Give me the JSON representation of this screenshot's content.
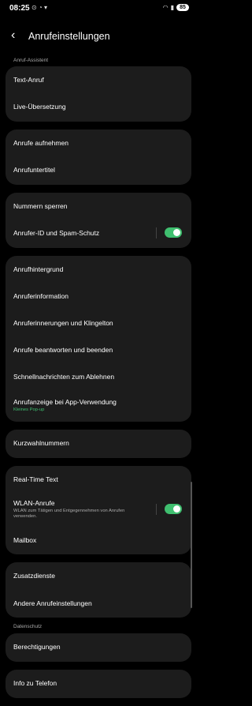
{
  "status": {
    "time": "08:25",
    "battery": "85"
  },
  "header": {
    "title": "Anrufeinstellungen"
  },
  "sections": {
    "assistant": "Anruf-Assistent",
    "privacy": "Datenschutz"
  },
  "items": {
    "text_call": "Text-Anruf",
    "live_translation": "Live-Übersetzung",
    "record_calls": "Anrufe aufnehmen",
    "call_subtitles": "Anrufuntertitel",
    "block_numbers": "Nummern sperren",
    "caller_id": "Anrufer-ID und Spam-Schutz",
    "call_background": "Anrufhintergrund",
    "caller_info": "Anruferinformation",
    "reminders": "Anruferinnerungen und Klingelton",
    "answer_end": "Anrufe beantworten und beenden",
    "quick_reject": "Schnellnachrichten zum Ablehnen",
    "call_display": "Anrufanzeige bei App-Verwendung",
    "call_display_sub": "Kleines Pop-up",
    "speed_dial": "Kurzwahlnummern",
    "rtt": "Real-Time Text",
    "wifi_calls": "WLAN-Anrufe",
    "wifi_calls_sub": "WLAN zum Tätigen und Entgegennehmen von Anrufen verwenden.",
    "mailbox": "Mailbox",
    "extra_services": "Zusatzdienste",
    "other_settings": "Andere Anrufeinstellungen",
    "permissions": "Berechtigungen",
    "about_phone": "Info zu Telefon"
  },
  "toggles": {
    "caller_id": true,
    "wifi_calls": true
  },
  "colors": {
    "accent": "#3fbf6f",
    "card": "#1c1c1c"
  },
  "icons": [
    "wifi-icon",
    "battery-icon",
    "back-arrow-icon"
  ]
}
